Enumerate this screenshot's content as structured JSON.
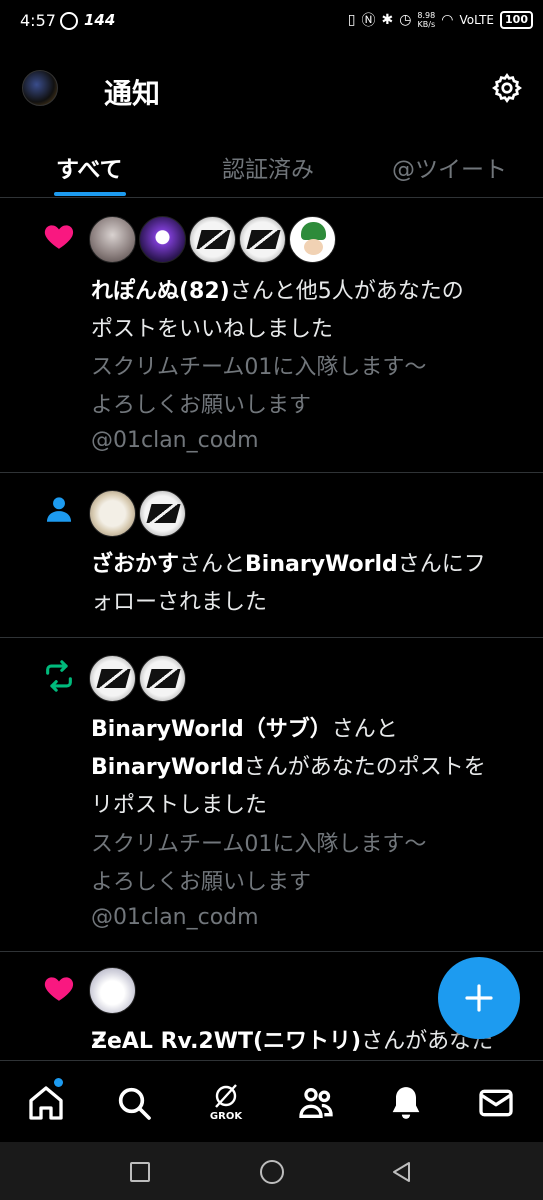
{
  "status_bar": {
    "time": "4:57",
    "refresh_rate": "144",
    "net_speed": "8.98",
    "net_unit": "KB/s",
    "network": "VoLTE",
    "battery": "100"
  },
  "header": {
    "title": "通知"
  },
  "tabs": [
    {
      "label": "すべて",
      "active": true
    },
    {
      "label": "認証済み",
      "active": false
    },
    {
      "label": "@ツイート",
      "active": false
    }
  ],
  "notifications": [
    {
      "type": "like",
      "actor_bold": "れぽんぬ(82)",
      "text_line1_rest": "さんと他5人があなたの",
      "text_line2": "ポストをいいねしました",
      "quote_line1": "スクリムチーム01に入隊します〜",
      "quote_line2": "よろしくお願いします",
      "handle": "@01clan_codm"
    },
    {
      "type": "follow",
      "actor1_bold": "ざおかす",
      "mid": "さんと",
      "actor2_bold": "BinaryWorld",
      "line1_end": "さんにフ",
      "line2": "ォローされました"
    },
    {
      "type": "repost",
      "actor1_bold": "BinaryWorld（サブ）",
      "line1_end": "さんと",
      "actor2_bold": "BinaryWorld",
      "line2_end": "さんがあなたのポストを",
      "line3": "リポストしました",
      "quote_line1": "スクリムチーム01に入隊します〜",
      "quote_line2": "よろしくお願いします",
      "handle": "@01clan_codm"
    },
    {
      "type": "like",
      "actor_bold": "ƵeAL Rv.2WT(ニワトリ)",
      "text_line1_rest": "さんがあなた"
    }
  ],
  "bottom_nav": {
    "grok_label": "GROK"
  },
  "colors": {
    "accent": "#1d9bf0",
    "like": "#f91880",
    "repost": "#00ba7c"
  }
}
